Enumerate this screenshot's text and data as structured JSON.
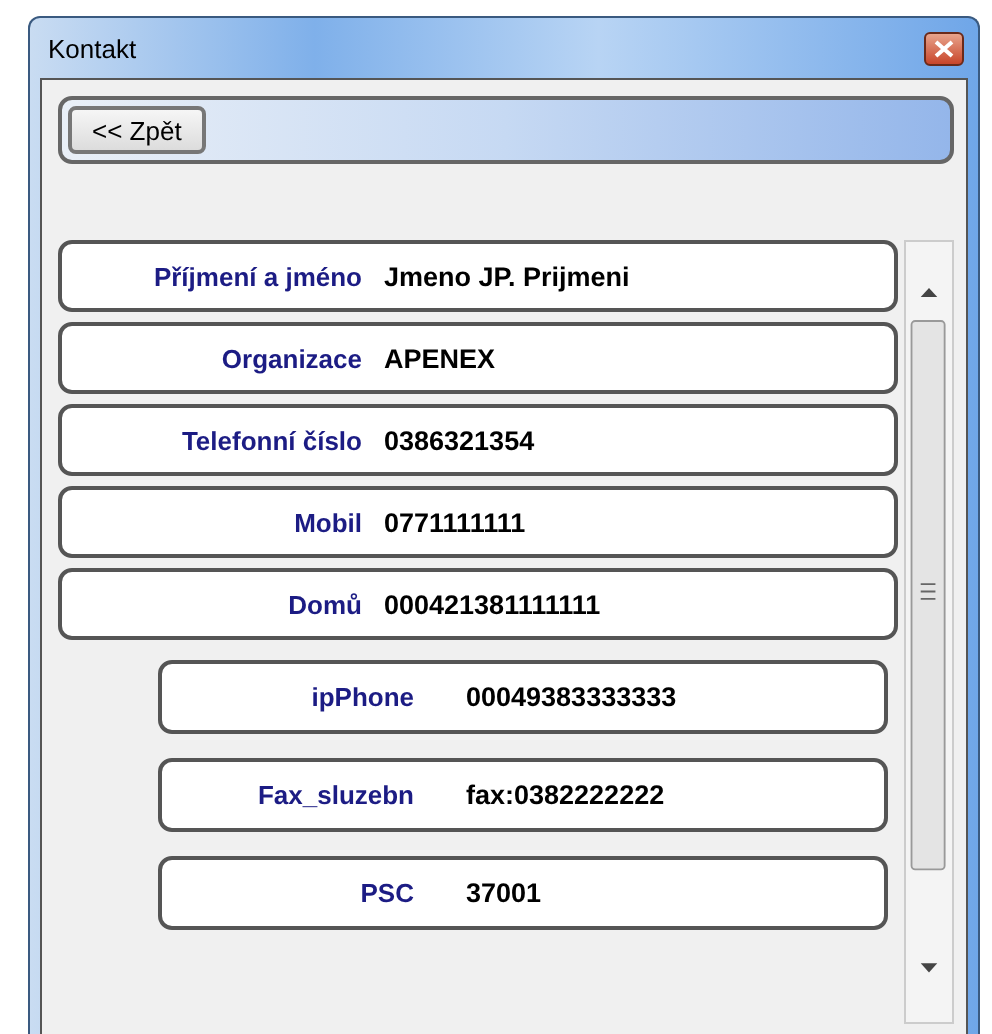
{
  "window": {
    "title": "Kontakt"
  },
  "toolbar": {
    "back_button": "<< Zpět"
  },
  "fields": [
    {
      "kind": "full",
      "label": "Příjmení a jméno",
      "value": "Jmeno JP. Prijmeni"
    },
    {
      "kind": "full",
      "label": "Organizace",
      "value": "APENEX"
    },
    {
      "kind": "full",
      "label": "Telefonní číslo",
      "value": "0386321354"
    },
    {
      "kind": "full",
      "label": "Mobil",
      "value": "0771111111"
    },
    {
      "kind": "full",
      "label": "Domů",
      "value": "000421381111111"
    },
    {
      "kind": "inset",
      "label": "ipPhone",
      "value": "00049383333333"
    },
    {
      "kind": "inset",
      "label": "Fax_sluzebn",
      "value": "fax:0382222222"
    },
    {
      "kind": "inset",
      "label": "PSC",
      "value": "37001"
    }
  ]
}
